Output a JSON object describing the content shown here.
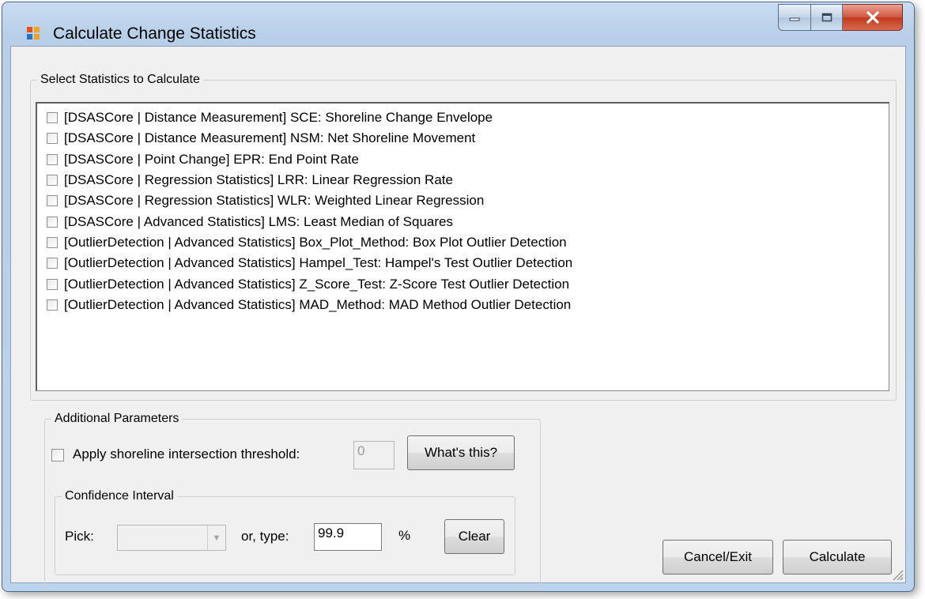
{
  "window": {
    "title": "Calculate Change Statistics"
  },
  "stats_group": {
    "label": "Select Statistics to Calculate",
    "items": [
      "[DSASCore | Distance Measurement] SCE: Shoreline Change Envelope",
      "[DSASCore | Distance Measurement] NSM: Net Shoreline Movement",
      "[DSASCore | Point Change] EPR: End Point Rate",
      "[DSASCore | Regression Statistics] LRR: Linear Regression Rate",
      "[DSASCore | Regression Statistics] WLR: Weighted Linear Regression",
      "[DSASCore | Advanced Statistics] LMS: Least Median of Squares",
      "[OutlierDetection | Advanced Statistics] Box_Plot_Method: Box Plot Outlier Detection",
      "[OutlierDetection | Advanced Statistics] Hampel_Test: Hampel's Test Outlier Detection",
      "[OutlierDetection | Advanced Statistics] Z_Score_Test: Z-Score Test Outlier Detection",
      "[OutlierDetection | Advanced Statistics] MAD_Method: MAD Method Outlier Detection"
    ]
  },
  "params_group": {
    "label": "Additional Parameters",
    "threshold_label": "Apply shoreline intersection threshold:",
    "threshold_value": "0",
    "whats_this_label": "What's this?"
  },
  "confidence_group": {
    "label": "Confidence Interval",
    "pick_label": "Pick:",
    "pick_value": "",
    "or_type_label": "or, type:",
    "type_value": "99.9",
    "percent_label": "%",
    "clear_label": "Clear"
  },
  "footer": {
    "cancel_label": "Cancel/Exit",
    "calculate_label": "Calculate"
  },
  "colors": {
    "accent_close": "#c0391e",
    "frame": "#b7cfe8"
  }
}
